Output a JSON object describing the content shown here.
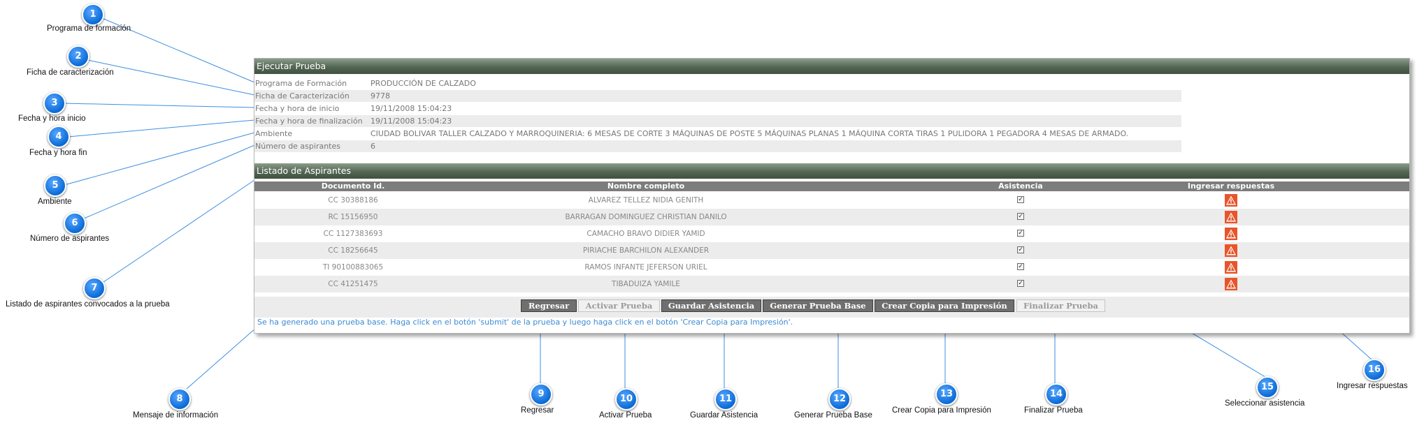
{
  "panel": {
    "title": "Ejecutar Prueba",
    "info_rows": [
      {
        "label": "Programa de Formación",
        "value": "PRODUCCIÓN DE CALZADO"
      },
      {
        "label": "Ficha de Caracterización",
        "value": "9778"
      },
      {
        "label": "Fecha y hora de inicio",
        "value": "19/11/2008 15:04:23"
      },
      {
        "label": "Fecha y hora de finalización",
        "value": "19/11/2008 15:04:23"
      },
      {
        "label": "Ambiente",
        "value": "CIUDAD BOLIVAR TALLER CALZADO Y MARROQUINERIA: 6 MESAS DE CORTE 3 MÁQUINAS DE POSTE 5 MÁQUINAS PLANAS 1 MÁQUINA CORTA TIRAS 1 PULIDORA 1 PEGADORA 4 MESAS DE ARMADO."
      },
      {
        "label": "Número de aspirantes",
        "value": "6"
      }
    ],
    "list_title": "Listado de Aspirantes",
    "columns": [
      "Documento Id.",
      "Nombre completo",
      "Asistencia",
      "Ingresar respuestas"
    ],
    "rows": [
      {
        "doc": "CC 30388186",
        "name": "ALVAREZ TELLEZ NIDIA GENITH",
        "attendance": true
      },
      {
        "doc": "RC 15156950",
        "name": "BARRAGAN DOMINGUEZ CHRISTIAN DANILO",
        "attendance": true
      },
      {
        "doc": "CC 1127383693",
        "name": "CAMACHO BRAVO DIDIER YAMID",
        "attendance": true
      },
      {
        "doc": "CC 18256645",
        "name": "PIRIACHE BARCHILON ALEXANDER",
        "attendance": true
      },
      {
        "doc": "TI 90100883065",
        "name": "RAMOS INFANTE JEFERSON URIEL",
        "attendance": true
      },
      {
        "doc": "CC 41251475",
        "name": "TIBADUIZA YAMILE",
        "attendance": true
      }
    ],
    "buttons": {
      "regresar": "Regresar",
      "activar": "Activar Prueba",
      "guardar": "Guardar Asistencia",
      "generar": "Generar Prueba Base",
      "crear": "Crear Copia para Impresión",
      "finalizar": "Finalizar Prueba"
    },
    "message": "Se ha generado una prueba base. Haga click en el botón 'submit' de la prueba y luego haga click en el botón 'Crear Copia para Impresión'."
  },
  "callouts": [
    {
      "n": "1",
      "label": "Programa de formación"
    },
    {
      "n": "2",
      "label": "Ficha de caracterización"
    },
    {
      "n": "3",
      "label": "Fecha y hora inicio"
    },
    {
      "n": "4",
      "label": "Fecha y hora fin"
    },
    {
      "n": "5",
      "label": "Ambiente"
    },
    {
      "n": "6",
      "label": "Número de aspirantes"
    },
    {
      "n": "7",
      "label": "Listado de aspirantes convocados a la prueba"
    },
    {
      "n": "8",
      "label": "Mensaje de información"
    },
    {
      "n": "9",
      "label": "Regresar"
    },
    {
      "n": "10",
      "label": "Activar Prueba"
    },
    {
      "n": "11",
      "label": "Guardar Asistencia"
    },
    {
      "n": "12",
      "label": "Generar Prueba Base"
    },
    {
      "n": "13",
      "label": "Crear Copia para Impresión"
    },
    {
      "n": "14",
      "label": "Finalizar Prueba"
    },
    {
      "n": "15",
      "label": "Seleccionar asistencia"
    },
    {
      "n": "16",
      "label": "Ingresar respuestas"
    }
  ]
}
